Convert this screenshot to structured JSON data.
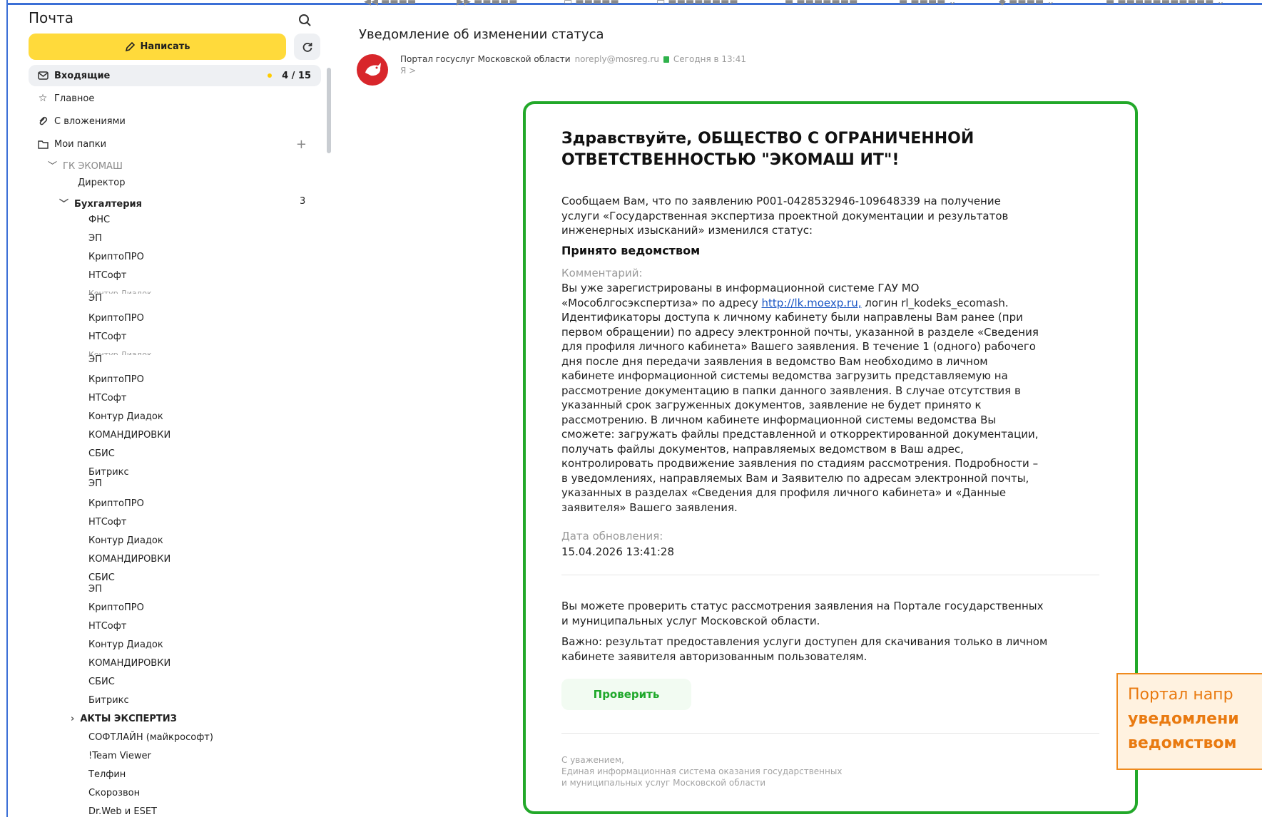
{
  "sidebar": {
    "title": "Почта",
    "compose_label": "Написать",
    "nav": [
      {
        "label": "Входящие",
        "count": "4 / 15"
      },
      {
        "label": "Главное"
      },
      {
        "label": "С вложениями"
      },
      {
        "label": "Мои папки"
      }
    ],
    "folders": {
      "group": "ГК ЭКОМАШ",
      "director": "Директор",
      "accounting": "Бухгалтерия",
      "accounting_count": "3",
      "items": [
        "ФНС",
        "ЭП",
        "КриптоПРО",
        "НТСофт",
        "Контур Диадок",
        "ЭП",
        "КриптоПРО",
        "НТСофт",
        "Контур Диадок",
        "ЭП",
        "КриптоПРО",
        "НТСофт",
        "Контур Диадок",
        "КОМАНДИРОВКИ",
        "СБИС",
        "Битрикс",
        "ЭП",
        "КриптоПРО",
        "НТСофт",
        "Контур Диадок",
        "КОМАНДИРОВКИ",
        "СБИС",
        "ЭП",
        "КриптоПРО",
        "НТСофт",
        "Контур Диадок",
        "КОМАНДИРОВКИ",
        "СБИС",
        "Битрикс"
      ],
      "expert_acts": "АКТЫ ЭКСПЕРТИЗ",
      "rest": [
        "СОФТЛАЙН (майкрософт)",
        "!Team Viewer",
        "Телфин",
        "Скорозвон",
        "Dr.Web и ESET"
      ]
    }
  },
  "message": {
    "subject": "Уведомление об изменении статуса",
    "sender_name": "Портал госуслуг Московской области",
    "sender_email": "noreply@mosreg.ru",
    "date": "Сегодня в 13:41",
    "to": "Я >"
  },
  "letter": {
    "greeting": "Здравствуйте, ОБЩЕСТВО С ОГРАНИЧЕННОЙ ОТВЕТСТВЕННОСТЬЮ \"ЭКОМАШ ИТ\"!",
    "intro_lines": [
      "Сообщаем Вам, что по заявлению P001-0428532946-109648339 на получение",
      "услуги «Государственная экспертиза проектной документации и результатов",
      "инженерных изысканий» изменился статус:"
    ],
    "status": "Принято ведомством",
    "comment_label": "Комментарий:",
    "comment_line1": "Вы уже зарегистрированы в информационной системе ГАУ МО",
    "comment_line2_pre": "«Мособлгосэкспертиза» по адресу ",
    "comment_link": "http://lk.moexp.ru,",
    "comment_line2_post": " логин rl_kodeks_ecomash.",
    "comment_lines": [
      "Идентификаторы доступа к личному кабинету были направлены Вам ранее (при",
      "первом обращении) по адресу электронной почты, указанной в разделе «Сведения",
      "для профиля личного кабинета» Вашего заявления. В течение 1 (одного) рабочего",
      "дня после дня передачи заявления в ведомство Вам необходимо в личном",
      "кабинете информационной системы ведомства загрузить представляемую на",
      "рассмотрение документацию в папки данного заявления. В случае отсутствия в",
      "указанный срок загруженных документов, заявление не будет принято к",
      "рассмотрению. В личном кабинете информационной системы ведомства Вы",
      "сможете: загружать файлы представленной и откорректированной документации,",
      "получать файлы документов, направляемых ведомством в Ваш адрес,",
      "контролировать продвижение заявления по стадиям рассмотрения. Подробности –",
      "в уведомлениях, направляемых Вам и Заявителю по адресам электронной почты,",
      "указанных в разделах «Сведения для профиля личного кабинета» и «Данные",
      "заявителя» Вашего заявления."
    ],
    "update_label": "Дата обновления:",
    "update_value": "15.04.2026 13:41:28",
    "check_lines": [
      "Вы можете проверить статус рассмотрения заявления на Портале государственных",
      "и муниципальных услуг Московской области."
    ],
    "important_lines": [
      "Важно: результат предоставления услуги доступен для скачивания только в личном",
      "кабинете заявителя авторизованным пользователям."
    ],
    "check_button": "Проверить",
    "signature": [
      "С уважением,",
      "Единая информационная система оказания государственных",
      "и муниципальных услуг Московской области"
    ]
  },
  "callout": {
    "line1": "Портал напр",
    "line2": "уведомлени",
    "line3": "ведомством"
  },
  "colors": {
    "compose": "#ffda3b",
    "letter_border": "#22a829",
    "callout": "#ef8a1d",
    "link": "#1a56c4"
  }
}
